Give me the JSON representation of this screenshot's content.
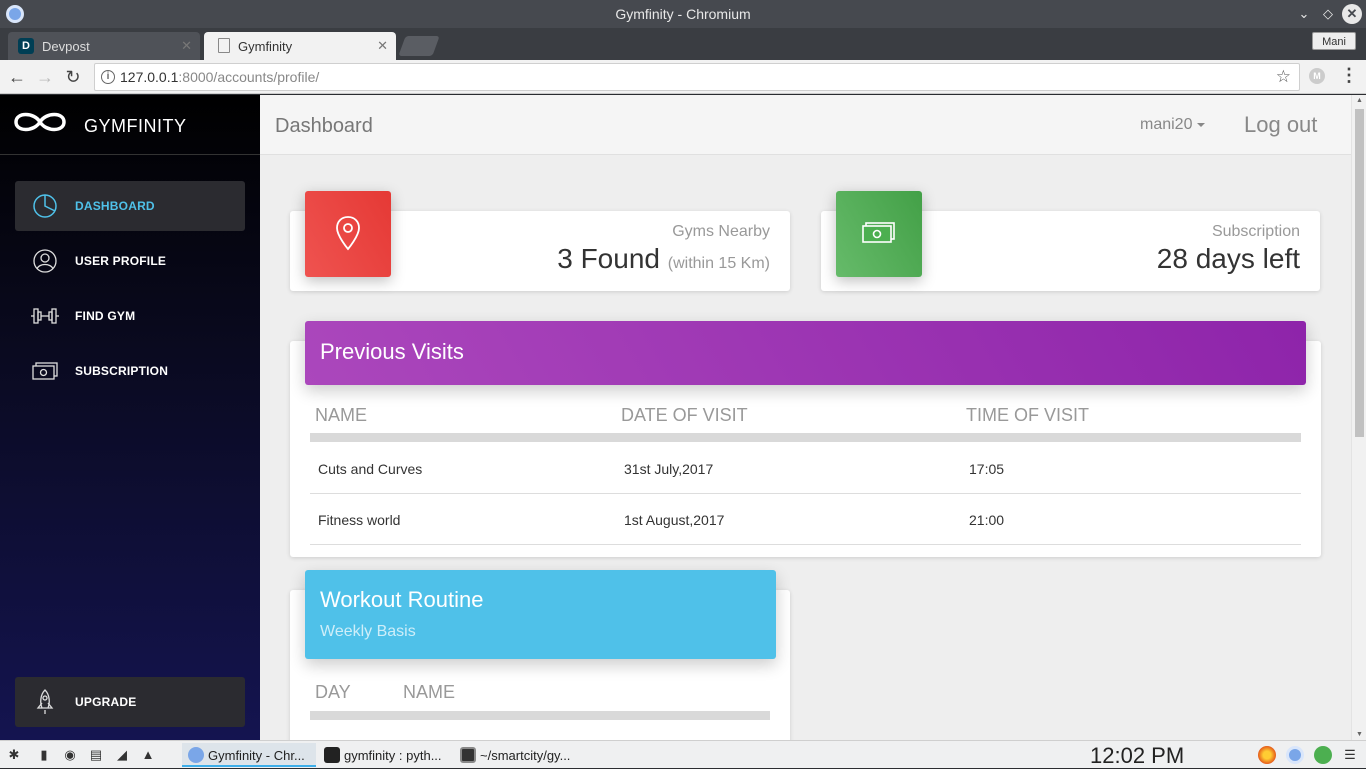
{
  "window": {
    "title": "Gymfinity - Chromium"
  },
  "tabs": [
    {
      "label": "Devpost",
      "favicon": "D"
    },
    {
      "label": "Gymfinity"
    }
  ],
  "profile_badge": "Mani",
  "address": {
    "host": "127.0.0.1",
    "path": ":8000/accounts/profile/"
  },
  "sidebar": {
    "brand": "GYMFINITY",
    "items": [
      {
        "label": "DASHBOARD",
        "icon": "pie-chart-icon"
      },
      {
        "label": "USER PROFILE",
        "icon": "user-icon"
      },
      {
        "label": "FIND GYM",
        "icon": "dumbbell-icon"
      },
      {
        "label": "SUBSCRIPTION",
        "icon": "money-icon"
      }
    ],
    "upgrade": "UPGRADE"
  },
  "header": {
    "title": "Dashboard",
    "user": "mani20",
    "logout": "Log out"
  },
  "stats": {
    "gyms": {
      "category": "Gyms Nearby",
      "value": "3 Found",
      "note": "(within 15 Km)",
      "color": "#ef5350"
    },
    "subscription": {
      "category": "Subscription",
      "value": "28 days left",
      "color": "#66bb6a"
    }
  },
  "visits": {
    "title": "Previous Visits",
    "color": "#9c27b0",
    "columns": [
      "NAME",
      "DATE OF VISIT",
      "TIME OF VISIT"
    ],
    "rows": [
      {
        "name": "Cuts and Curves",
        "date": "31st July,2017",
        "time": "17:05"
      },
      {
        "name": "Fitness world",
        "date": "1st August,2017",
        "time": "21:00"
      }
    ]
  },
  "workout": {
    "title": "Workout Routine",
    "subtitle": "Weekly Basis",
    "color": "#4fc1e9",
    "columns": [
      "DAY",
      "NAME"
    ]
  },
  "taskbar": {
    "tasks": [
      {
        "label": "Gymfinity - Chr..."
      },
      {
        "label": "gymfinity : pyth..."
      },
      {
        "label": "~/smartcity/gy..."
      }
    ],
    "clock": "12:02 PM"
  }
}
